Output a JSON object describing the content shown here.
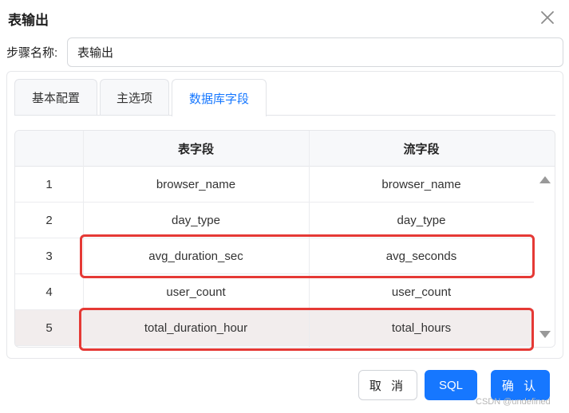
{
  "dialog": {
    "title": "表输出",
    "close_icon": "close-icon"
  },
  "step": {
    "label": "步骤名称:",
    "value": "表输出"
  },
  "tabs": [
    {
      "label": "基本配置",
      "active": false
    },
    {
      "label": "主选项",
      "active": false
    },
    {
      "label": "数据库字段",
      "active": true
    }
  ],
  "table": {
    "columns": [
      "",
      "表字段",
      "流字段"
    ],
    "rows": [
      {
        "index": "1",
        "table_field": "browser_name",
        "stream_field": "browser_name"
      },
      {
        "index": "2",
        "table_field": "day_type",
        "stream_field": "day_type"
      },
      {
        "index": "3",
        "table_field": "avg_duration_sec",
        "stream_field": "avg_seconds"
      },
      {
        "index": "4",
        "table_field": "user_count",
        "stream_field": "user_count"
      },
      {
        "index": "5",
        "table_field": "total_duration_hour",
        "stream_field": "total_hours"
      }
    ]
  },
  "buttons": {
    "cancel": "取 消",
    "sql": "SQL",
    "confirm": "确 认"
  },
  "watermark": "CSDN @undefined",
  "colors": {
    "primary": "#1677ff",
    "highlight_box": "#e53935",
    "selected_row": "#f2eded"
  }
}
